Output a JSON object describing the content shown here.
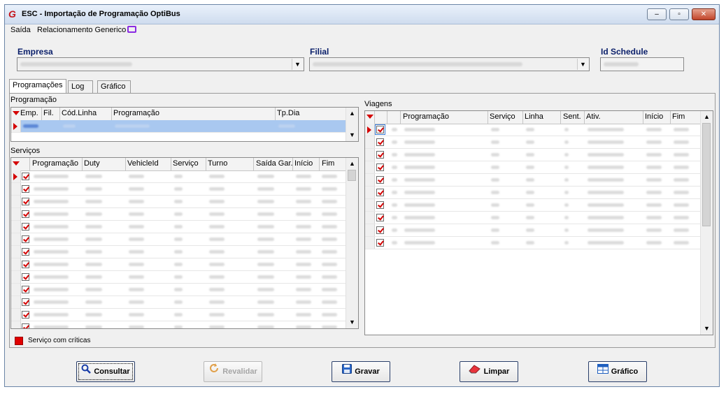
{
  "window": {
    "title": "ESC - Importação de Programação OptiBus",
    "logo_letter": "G",
    "buttons": {
      "minimize": "–",
      "restore": "▫",
      "close": "✕"
    }
  },
  "menu": [
    {
      "label": "Saída"
    },
    {
      "label": "Relacionamento Generico"
    }
  ],
  "filters": {
    "empresa_label": "Empresa",
    "filial_label": "Filial",
    "id_schedule_label": "Id Schedule"
  },
  "tabs": [
    {
      "label": "Programações",
      "active": true
    },
    {
      "label": "Log",
      "active": false
    },
    {
      "label": "Gráfico",
      "active": false
    }
  ],
  "programacao": {
    "group_label": "Programação",
    "columns": [
      "Emp.",
      "Fil.",
      "Cód.Linha",
      "Programação",
      "Tp.Dia"
    ],
    "row_count": 1
  },
  "servicos": {
    "group_label": "Serviços",
    "columns": [
      "Programação",
      "Duty",
      "VehicleId",
      "Serviço",
      "Turno",
      "Saída Gar.",
      "Início",
      "Fim"
    ],
    "row_count": 13
  },
  "viagens": {
    "group_label": "Viagens",
    "columns": [
      "Programação",
      "Serviço",
      "Linha",
      "Sent.",
      "Ativ.",
      "Início",
      "Fim"
    ],
    "row_count": 10
  },
  "legend": {
    "label": "Serviço com críticas",
    "color": "#e00000"
  },
  "actions": [
    {
      "label": "Consultar",
      "icon": "search-icon",
      "enabled": true
    },
    {
      "label": "Revalidar",
      "icon": "refresh-icon",
      "enabled": false
    },
    {
      "label": "Gravar",
      "icon": "floppy-disk-icon",
      "enabled": true
    },
    {
      "label": "Limpar",
      "icon": "eraser-icon",
      "enabled": true
    },
    {
      "label": "Gráfico",
      "icon": "grid-chart-icon",
      "enabled": true
    }
  ]
}
